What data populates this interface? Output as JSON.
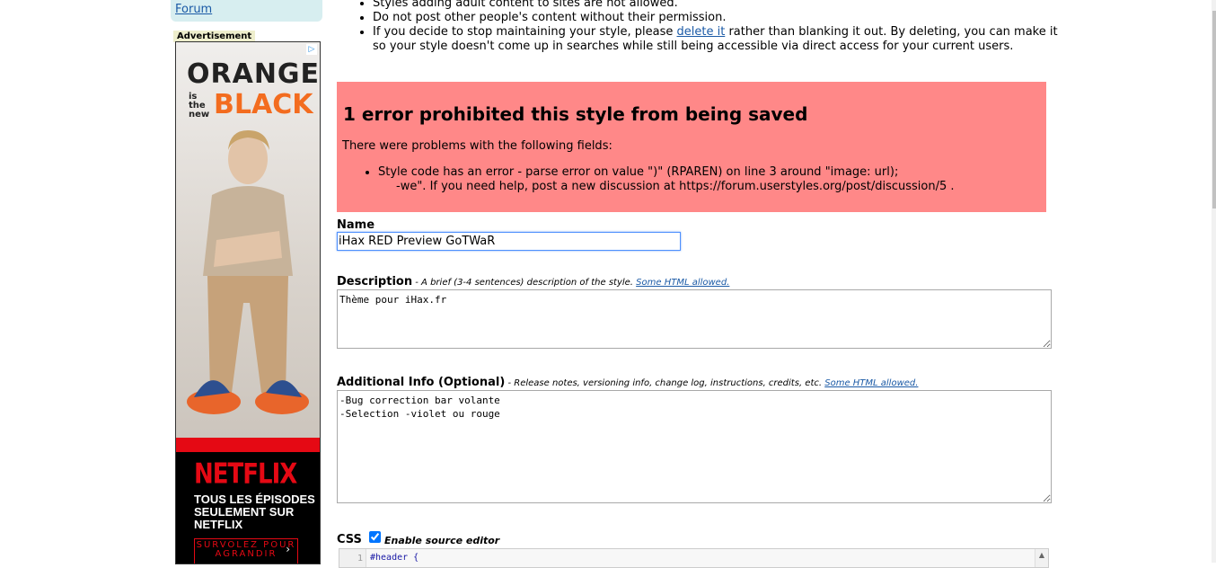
{
  "sidebar": {
    "forum_link": "Forum",
    "ad_label": "Advertisement",
    "ad": {
      "orange": "ORANGE",
      "is_the_new": "is\nthe\nnew",
      "black": "BLACK",
      "netflix": "NETFLIX",
      "tagline": "TOUS LES ÉPISODES\nSEULEMENT SUR\nNETFLIX",
      "cta": "SURVOLEZ POUR AGRANDIR",
      "cta_arrow": "›"
    }
  },
  "rules": {
    "items": [
      "Styles adding adult content to sites are not allowed.",
      "Do not post other people's content without their permission."
    ],
    "delete_rule_before": "If you decide to stop maintaining your style, please ",
    "delete_link": "delete it",
    "delete_rule_after": " rather than blanking it out. By deleting, you can make it so your style doesn't come up in searches while still being accessible via direct access for your current users."
  },
  "error": {
    "title": "1 error prohibited this style from being saved",
    "intro": "There were problems with the following fields:",
    "message_line1": "Style code has an error - parse error on value \")\" (RPAREN) on line 3 around \"image: url);",
    "message_line2": "-we\". If you need help, post a new discussion at https://forum.userstyles.org/post/discussion/5 ."
  },
  "form": {
    "name": {
      "label": "Name",
      "value": "iHax RED Preview GoTWaR"
    },
    "description": {
      "label": "Description",
      "hint_text": " - A brief (3-4 sentences) description of the style. ",
      "hint_link": "Some HTML allowed.",
      "value": "Thème pour iHax.fr"
    },
    "additional_info": {
      "label": "Additional Info (Optional)",
      "hint_text": " - Release notes, versioning info, change log, instructions, credits, etc. ",
      "hint_link": "Some HTML allowed.",
      "value": "-Bug correction bar volante\n-Selection -violet ou rouge"
    },
    "css": {
      "label": "CSS",
      "enable_editor_label": "Enable source editor",
      "enable_editor_checked": true,
      "first_line_number": "1",
      "first_line_code": "#header {"
    }
  },
  "colors": {
    "error_bg": "#ff8888",
    "link": "#1b5aa6",
    "sidebar_bg": "#d7eef0",
    "netflix_red": "#e50914",
    "oitnb_orange": "#f36c1f"
  }
}
